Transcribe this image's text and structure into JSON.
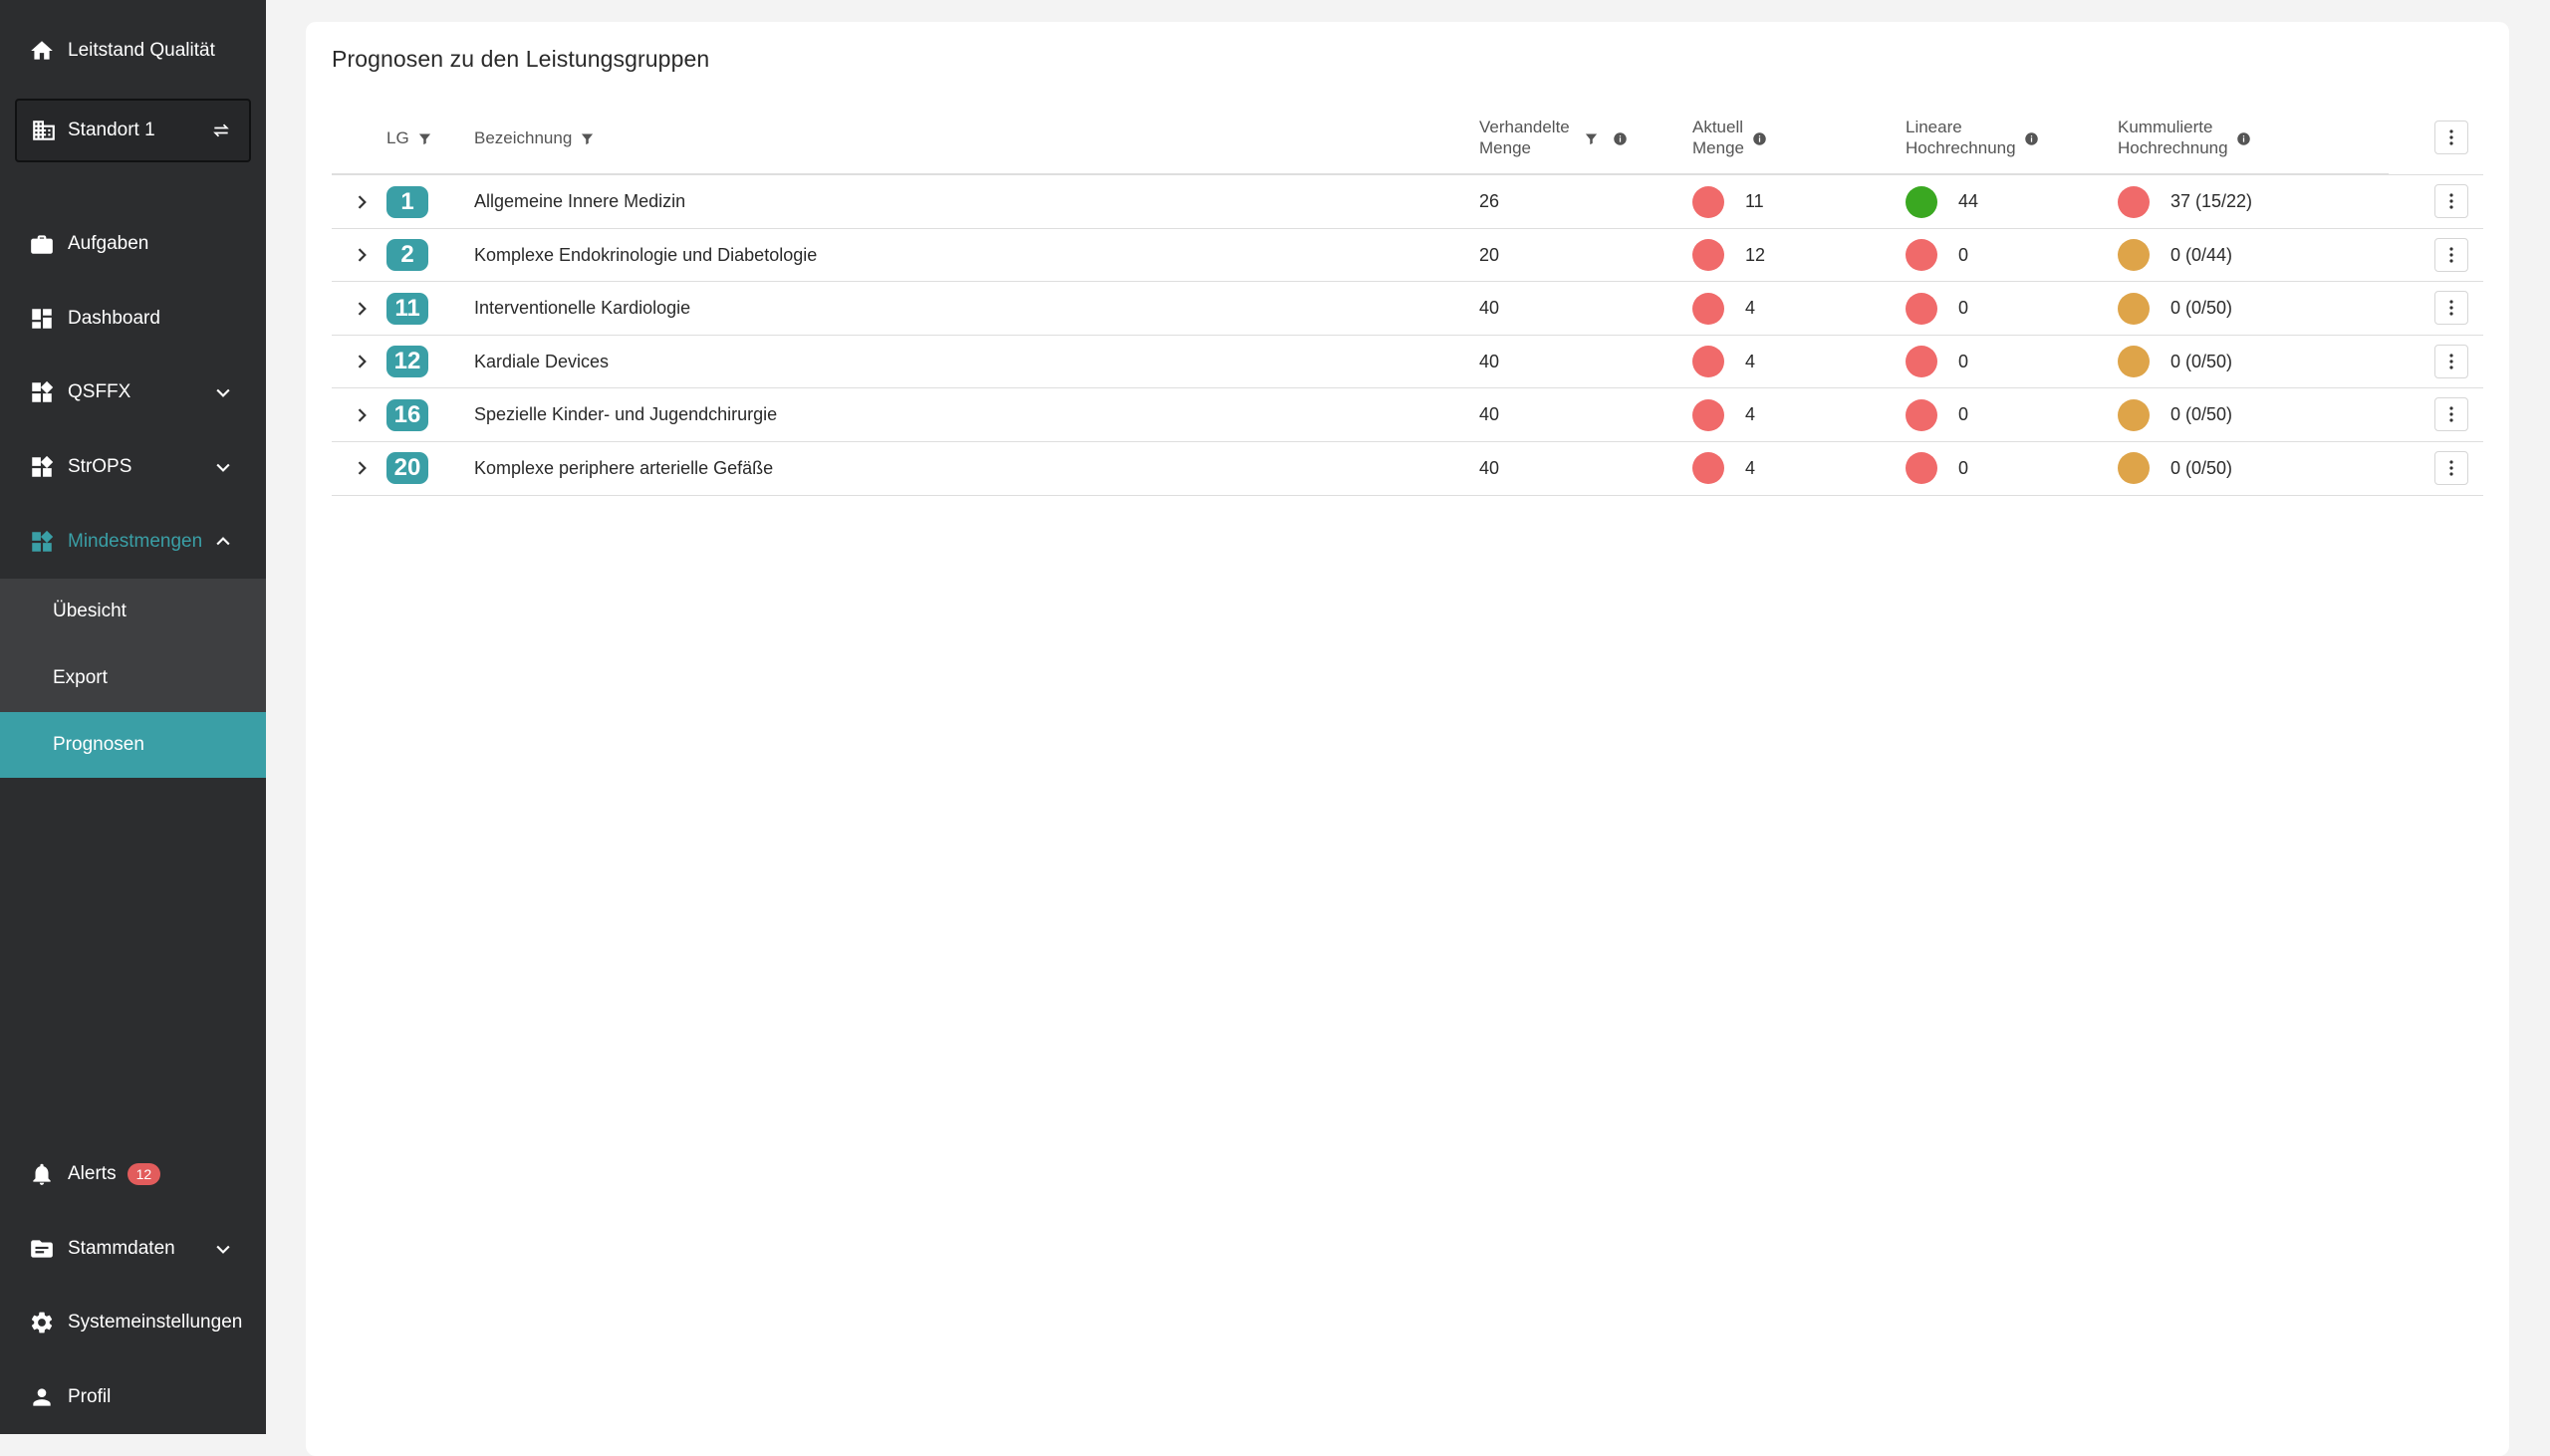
{
  "sidebar": {
    "app_title": "Leitstand Qualität",
    "location": "Standort 1",
    "items": [
      {
        "label": "Aufgaben"
      },
      {
        "label": "Dashboard"
      },
      {
        "label": "QSFFX"
      },
      {
        "label": "StrOPS"
      },
      {
        "label": "Mindestmengen"
      }
    ],
    "submenu": [
      {
        "label": "Übesicht"
      },
      {
        "label": "Export"
      },
      {
        "label": "Prognosen"
      }
    ],
    "bottom": [
      {
        "label": "Alerts",
        "badge": "12"
      },
      {
        "label": "Stammdaten"
      },
      {
        "label": "Systemeinstellungen"
      },
      {
        "label": "Profil"
      }
    ]
  },
  "main": {
    "title": "Prognosen zu den Leistungsgruppen",
    "columns": {
      "lg": "LG",
      "bezeichnung": "Bezeichnung",
      "verhandelte_1": "Verhandelte",
      "verhandelte_2": "Menge",
      "aktuell_1": "Aktuell",
      "aktuell_2": "Menge",
      "linear_1": "Lineare",
      "linear_2": "Hochrechnung",
      "kumm_1": "Kummulierte",
      "kumm_2": "Hochrechnung"
    },
    "rows": [
      {
        "lg": "1",
        "bezeichnung": "Allgemeine Innere Medizin",
        "verhandelt": "26",
        "aktuell": "11",
        "aktuell_status": "red",
        "linear": "44",
        "linear_status": "green",
        "kumm": "37 (15/22)",
        "kumm_status": "red"
      },
      {
        "lg": "2",
        "bezeichnung": "Komplexe Endokrinologie und Diabetologie",
        "verhandelt": "20",
        "aktuell": "12",
        "aktuell_status": "red",
        "linear": "0",
        "linear_status": "red",
        "kumm": "0 (0/44)",
        "kumm_status": "orange"
      },
      {
        "lg": "11",
        "bezeichnung": "Interventionelle Kardiologie",
        "verhandelt": "40",
        "aktuell": "4",
        "aktuell_status": "red",
        "linear": "0",
        "linear_status": "red",
        "kumm": "0 (0/50)",
        "kumm_status": "orange"
      },
      {
        "lg": "12",
        "bezeichnung": "Kardiale Devices",
        "verhandelt": "40",
        "aktuell": "4",
        "aktuell_status": "red",
        "linear": "0",
        "linear_status": "red",
        "kumm": "0 (0/50)",
        "kumm_status": "orange"
      },
      {
        "lg": "16",
        "bezeichnung": "Spezielle Kinder- und  Jugendchirurgie",
        "verhandelt": "40",
        "aktuell": "4",
        "aktuell_status": "red",
        "linear": "0",
        "linear_status": "red",
        "kumm": "0 (0/50)",
        "kumm_status": "orange"
      },
      {
        "lg": "20",
        "bezeichnung": "Komplexe periphere arterielle Gefäße",
        "verhandelt": "40",
        "aktuell": "4",
        "aktuell_status": "red",
        "linear": "0",
        "linear_status": "red",
        "kumm": "0 (0/50)",
        "kumm_status": "orange"
      }
    ]
  },
  "colors": {
    "accent": "#3a9fa6",
    "red": "#f06a6a",
    "green": "#3aa821",
    "orange": "#dea449",
    "sidebar_bg": "#2c2d2f"
  },
  "icons": {
    "home": "home-icon",
    "building": "building-icon",
    "swap": "swap-icon",
    "briefcase": "briefcase-icon",
    "dashboard": "dashboard-icon",
    "widgets": "widgets-icon",
    "bell": "bell-icon",
    "folder": "folder-icon",
    "gear": "gear-icon",
    "person": "person-icon",
    "filter": "filter-icon",
    "info": "info-icon",
    "chevron": "chevron-icon",
    "more": "more-vert-icon"
  }
}
